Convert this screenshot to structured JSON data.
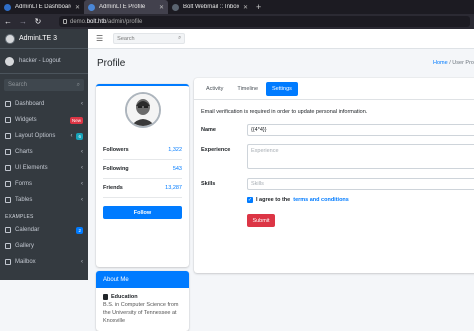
{
  "browser": {
    "tabs": [
      {
        "title": "AdminLTE Dashboard",
        "active": false,
        "color": "#2f6ec8"
      },
      {
        "title": "AdminLTE Profile",
        "active": true,
        "color": "#4a87d8"
      },
      {
        "title": "Bolt Webmail :: Inbox",
        "active": false,
        "color": "#5a6470"
      }
    ],
    "new_tab": "+",
    "url_prefix": "demo.",
    "url_host": "bolt.htb",
    "url_path": "/admin/profile"
  },
  "sidebar": {
    "brand": "AdminLTE 3",
    "user": "hacker - Logout",
    "search_placeholder": "Search",
    "items": [
      {
        "label": "Dashboard",
        "chevron": "‹"
      },
      {
        "label": "Widgets",
        "badge": "New",
        "badge_color": "#dc3545"
      },
      {
        "label": "Layout Options",
        "chevron": "‹",
        "badge": "6",
        "badge_color": "#17a2b8"
      },
      {
        "label": "Charts",
        "chevron": "‹"
      },
      {
        "label": "UI Elements",
        "chevron": "‹"
      },
      {
        "label": "Forms",
        "chevron": "‹"
      },
      {
        "label": "Tables",
        "chevron": "‹"
      }
    ],
    "section_examples": "EXAMPLES",
    "examples": [
      {
        "label": "Calendar",
        "badge": "2",
        "badge_color": "#007bff"
      },
      {
        "label": "Gallery"
      },
      {
        "label": "Mailbox",
        "chevron": "‹"
      }
    ]
  },
  "topnav": {
    "search_placeholder": "Search"
  },
  "page": {
    "title": "Profile",
    "breadcrumb_home": "Home",
    "breadcrumb_current": "User Pro"
  },
  "profile": {
    "stats": [
      {
        "label": "Followers",
        "value": "1,322"
      },
      {
        "label": "Following",
        "value": "543"
      },
      {
        "label": "Friends",
        "value": "13,287"
      }
    ],
    "follow_button": "Follow"
  },
  "about": {
    "title": "About Me",
    "education_heading": "Education",
    "education_text": "B.S. in Computer Science from the University of Tennessee at Knoxville"
  },
  "settings": {
    "tabs": [
      {
        "label": "Activity",
        "active": false
      },
      {
        "label": "Timeline",
        "active": false
      },
      {
        "label": "Settings",
        "active": true
      }
    ],
    "note": "Email verification is required in order to update personal information.",
    "name_label": "Name",
    "name_value": "{{4*4}}",
    "experience_label": "Experience",
    "experience_placeholder": "Experience",
    "skills_label": "Skills",
    "skills_placeholder": "Skills",
    "agree_prefix": "I agree to the",
    "agree_link": "terms and conditions",
    "submit_label": "Submit"
  }
}
